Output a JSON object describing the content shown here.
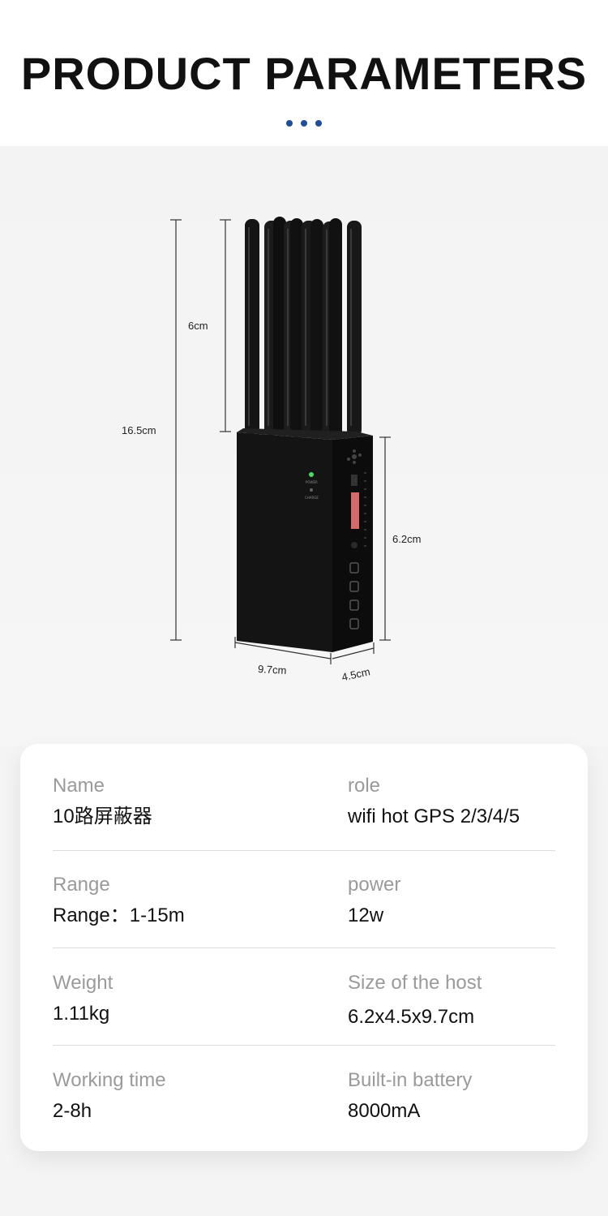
{
  "header": {
    "title": "PRODUCT PARAMETERS",
    "dot_color": "#1f4e96"
  },
  "product_image": {
    "dimensions": {
      "total_height": "16.5cm",
      "antenna_height": "6cm",
      "body_height": "6.2cm",
      "width": "9.7cm",
      "depth": "4.5cm"
    },
    "panel_labels": {
      "power": "POWER",
      "charge": "CHARGE"
    }
  },
  "specs": [
    {
      "left": {
        "label": "Name",
        "value": "10路屏蔽器"
      },
      "right": {
        "label": "role",
        "value": "wifi hot GPS 2/3/4/5"
      }
    },
    {
      "left": {
        "label": "Range",
        "value": "Range：1-15m"
      },
      "right": {
        "label": "power",
        "value": "12w"
      }
    },
    {
      "left": {
        "label": "Weight",
        "value": "1.11kg"
      },
      "right": {
        "label": "Size of the host",
        "value": "6.2x4.5x9.7cm"
      }
    },
    {
      "left": {
        "label": "Working time",
        "value": "2-8h"
      },
      "right": {
        "label": "Built-in battery",
        "value": "8000mA"
      }
    }
  ]
}
